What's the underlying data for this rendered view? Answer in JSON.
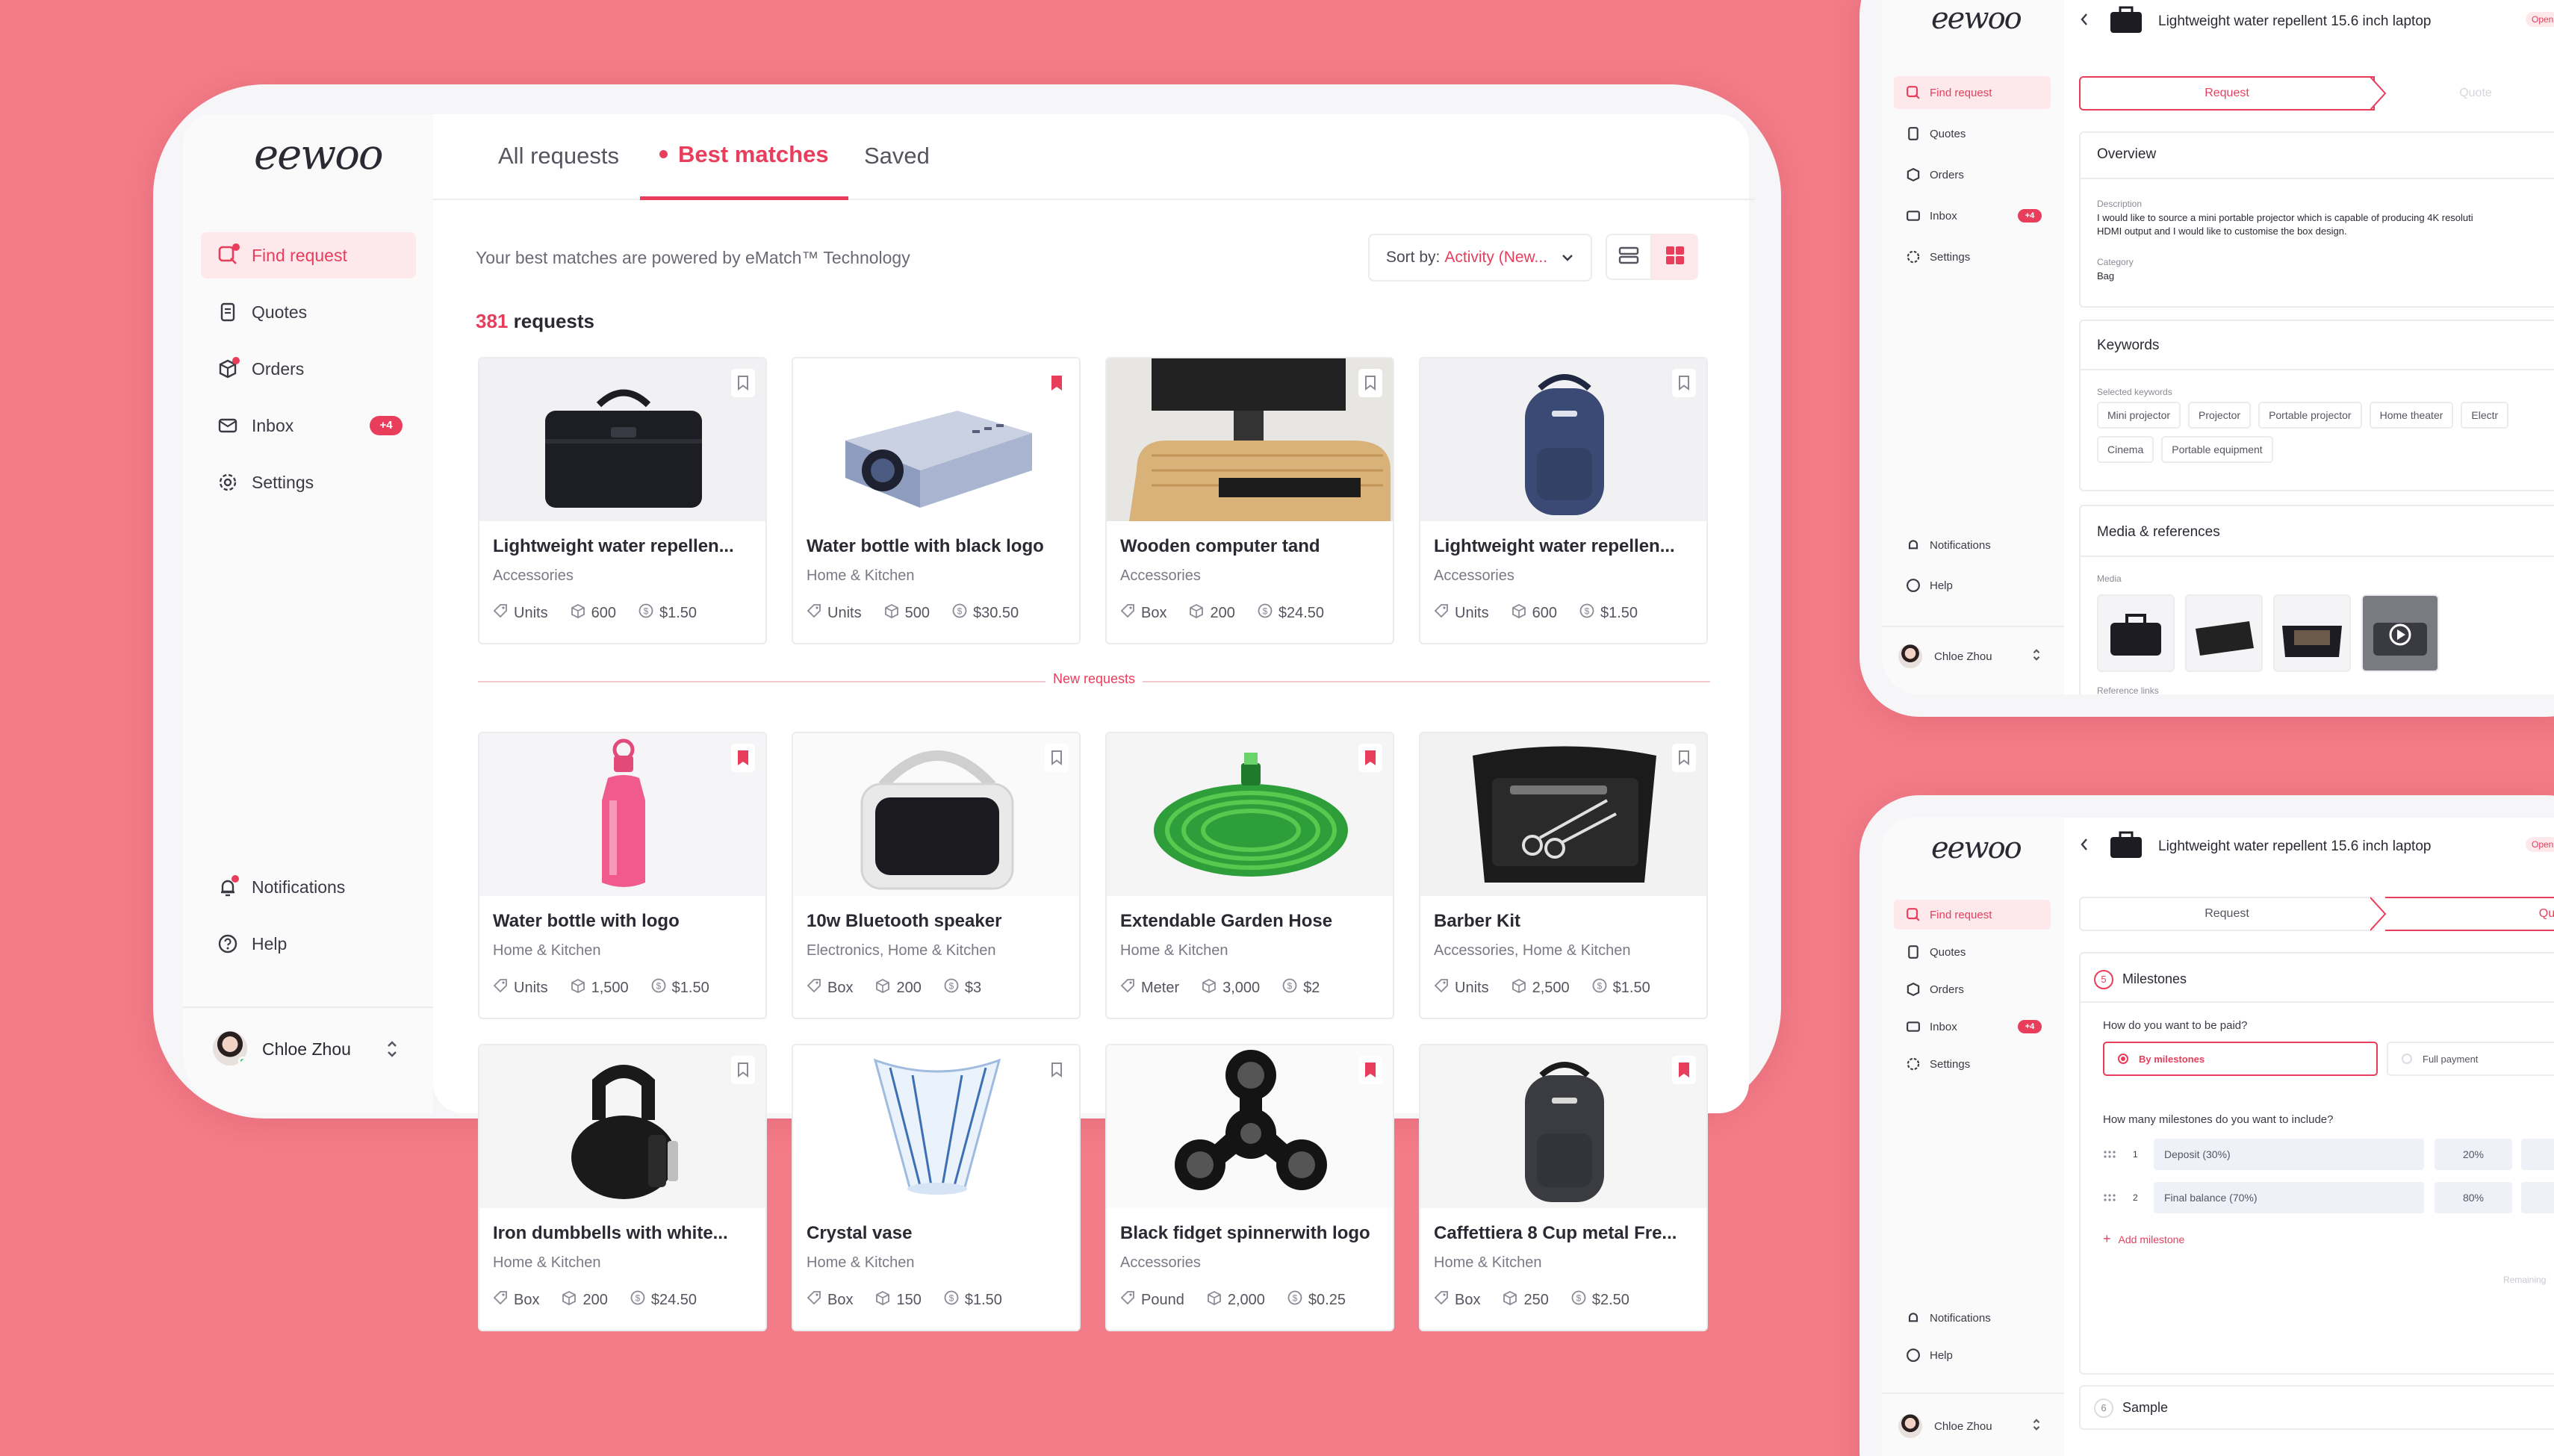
{
  "brand": {
    "logo": "eewoo",
    "accent": "#e83e5c",
    "background": "#f27c88"
  },
  "sidebar": {
    "items": [
      {
        "label": "Find request",
        "icon": "find-request-icon"
      },
      {
        "label": "Quotes",
        "icon": "quotes-icon"
      },
      {
        "label": "Orders",
        "icon": "orders-icon"
      },
      {
        "label": "Inbox",
        "icon": "inbox-icon",
        "badge": "+4"
      },
      {
        "label": "Settings",
        "icon": "gear-icon"
      }
    ],
    "bottom": [
      {
        "label": "Notifications",
        "icon": "bell-icon"
      },
      {
        "label": "Help",
        "icon": "help-icon"
      }
    ],
    "user": {
      "name": "Chloe Zhou"
    }
  },
  "tabs": [
    {
      "label": "All requests"
    },
    {
      "label": "Best matches"
    },
    {
      "label": "Saved"
    }
  ],
  "header": {
    "caption": "Your best matches are powered by eMatch™ Technology",
    "sort_label": "Sort by:",
    "sort_value": "Activity (New...",
    "count": "381",
    "count_suffix": " requests"
  },
  "divider_label": "New requests",
  "cards": [
    {
      "title": "Lightweight water repellen...",
      "category": "Accessories",
      "unit": "Units",
      "qty": "600",
      "price": "$1.50",
      "saved": false,
      "image": "laptop-bag"
    },
    {
      "title": "Water bottle with black logo",
      "category": "Home & Kitchen",
      "unit": "Units",
      "qty": "500",
      "price": "$30.50",
      "saved": true,
      "image": "projector"
    },
    {
      "title": "Wooden computer tand",
      "category": "Accessories",
      "unit": "Box",
      "qty": "200",
      "price": "$24.50",
      "saved": false,
      "image": "monitor-stand"
    },
    {
      "title": "Lightweight water repellen...",
      "category": "Accessories",
      "unit": "Units",
      "qty": "600",
      "price": "$1.50",
      "saved": false,
      "image": "backpack-blue"
    },
    {
      "title": "Water bottle with logo",
      "category": "Home & Kitchen",
      "unit": "Units",
      "qty": "1,500",
      "price": "$1.50",
      "saved": true,
      "image": "bottle"
    },
    {
      "title": "10w Bluetooth speaker",
      "category": "Electronics, Home & Kitchen",
      "unit": "Box",
      "qty": "200",
      "price": "$3",
      "saved": false,
      "image": "speaker"
    },
    {
      "title": "Extendable Garden Hose",
      "category": "Home & Kitchen",
      "unit": "Meter",
      "qty": "3,000",
      "price": "$2",
      "saved": true,
      "image": "hose"
    },
    {
      "title": "Barber Kit",
      "category": "Accessories, Home & Kitchen",
      "unit": "Units",
      "qty": "2,500",
      "price": "$1.50",
      "saved": false,
      "image": "barber-kit"
    },
    {
      "title": "Iron dumbbells with white...",
      "category": "Home & Kitchen",
      "unit": "Box",
      "qty": "200",
      "price": "$24.50",
      "saved": false,
      "image": "kettlebell"
    },
    {
      "title": "Crystal vase",
      "category": "Home & Kitchen",
      "unit": "Box",
      "qty": "150",
      "price": "$1.50",
      "saved": false,
      "image": "vase"
    },
    {
      "title": "Black fidget spinnerwith logo",
      "category": "Accessories",
      "unit": "Pound",
      "qty": "2,000",
      "price": "$0.25",
      "saved": true,
      "image": "spinner"
    },
    {
      "title": "Caffettiera 8 Cup metal Fre...",
      "category": "Home & Kitchen",
      "unit": "Box",
      "qty": "250",
      "price": "$2.50",
      "saved": true,
      "image": "backpack-dark"
    }
  ],
  "detail_top": {
    "title": "Lightweight water repellent 15.6 inch laptop",
    "status": "Open",
    "steps": [
      "Request",
      "Quote"
    ],
    "overview": {
      "heading": "Overview",
      "desc_label": "Description",
      "desc_line1": "I would like to source a mini portable projector which is capable of producing 4K resoluti",
      "desc_line2": "HDMI output and I would like to customise the box design.",
      "cat_label": "Category",
      "cat_value": "Bag"
    },
    "keywords": {
      "heading": "Keywords",
      "label": "Selected keywords",
      "row1": [
        "Mini projector",
        "Projector",
        "Portable projector",
        "Home theater",
        "Electr"
      ],
      "row2": [
        "Cinema",
        "Portable equipment"
      ]
    },
    "media": {
      "heading": "Media & references",
      "label": "Media",
      "sublabel": "Reference links"
    }
  },
  "detail_bottom": {
    "title": "Lightweight water repellent 15.6 inch laptop",
    "status": "Open",
    "steps": [
      "Request",
      "Quo"
    ],
    "milestones": {
      "number": "5",
      "heading": "Milestones",
      "question1": "How do you want to be paid?",
      "option_a": "By milestones",
      "option_b": "Full payment",
      "question2": "How many milestones do you want to include?",
      "rows": [
        {
          "n": "1",
          "name": "Deposit (30%)",
          "pct": "20%"
        },
        {
          "n": "2",
          "name": "Final balance (70%)",
          "pct": "80%"
        }
      ],
      "add": "Add milestone",
      "remaining": "Remaining"
    },
    "sample": {
      "number": "6",
      "heading": "Sample"
    }
  }
}
